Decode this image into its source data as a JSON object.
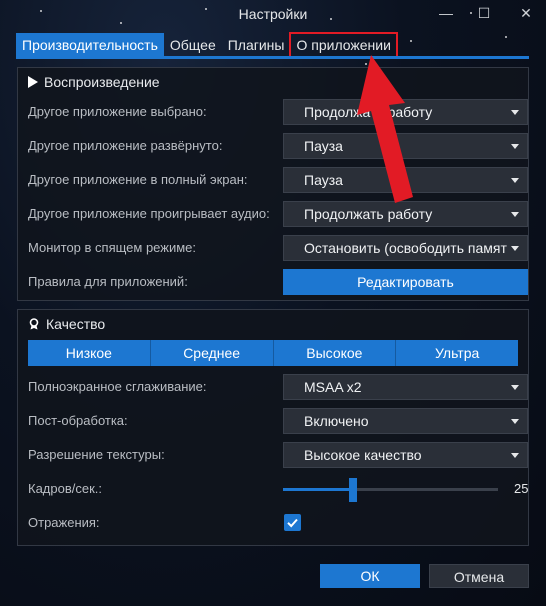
{
  "window": {
    "title": "Настройки",
    "min_glyph": "—",
    "max_glyph": "☐",
    "close_glyph": "✕"
  },
  "tabs": [
    {
      "label": "Производительность",
      "active": true
    },
    {
      "label": "Общее",
      "active": false
    },
    {
      "label": "Плагины",
      "active": false
    },
    {
      "label": "О приложении",
      "active": false,
      "highlighted": true
    }
  ],
  "playback": {
    "title": "Воспроизведение",
    "rows": [
      {
        "label": "Другое приложение выбрано:",
        "value": "Продолжать работу"
      },
      {
        "label": "Другое приложение развёрнуто:",
        "value": "Пауза"
      },
      {
        "label": "Другое приложение в полный экран:",
        "value": "Пауза"
      },
      {
        "label": "Другое приложение проигрывает аудио:",
        "value": "Продолжать работу"
      },
      {
        "label": "Монитор в спящем режиме:",
        "value": "Остановить (освободить памят"
      }
    ],
    "rules_label": "Правила для приложений:",
    "edit_button": "Редактировать"
  },
  "quality": {
    "title": "Качество",
    "levels": [
      "Низкое",
      "Среднее",
      "Высокое",
      "Ультра"
    ],
    "antialias_label": "Полноэкранное сглаживание:",
    "antialias_value": "MSAA x2",
    "postprocess_label": "Пост-обработка:",
    "postprocess_value": "Включено",
    "texture_label": "Разрешение текстуры:",
    "texture_value": "Высокое качество",
    "fps_label": "Кадров/сек.:",
    "fps_value": "25",
    "fps_level": 0.32,
    "reflections_label": "Отражения:",
    "reflections_checked": true
  },
  "footer": {
    "ok": "ОК",
    "cancel": "Отмена"
  },
  "colors": {
    "accent": "#1d77d1",
    "highlight_annotation": "#e21b25"
  }
}
